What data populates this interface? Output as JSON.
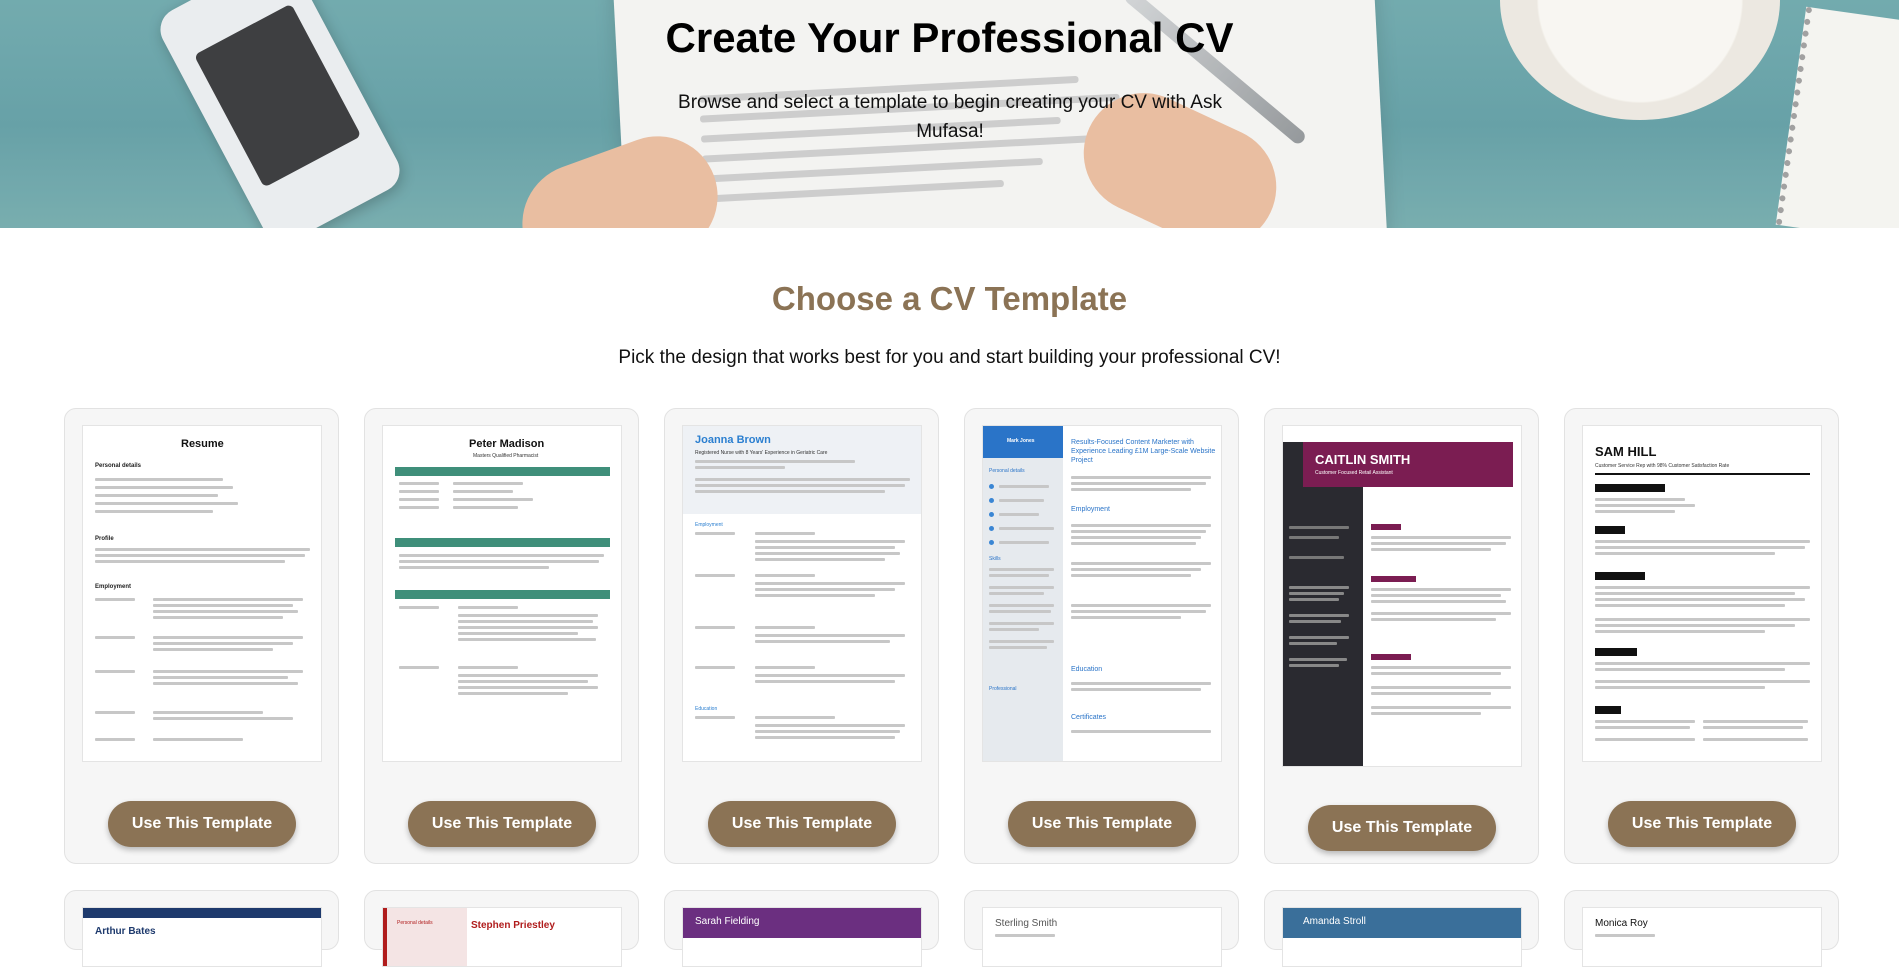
{
  "hero": {
    "title": "Create Your Professional CV",
    "subtitle": "Browse and select a template to begin creating your CV with Ask Mufasa!"
  },
  "section": {
    "title": "Choose a CV Template",
    "subtitle": "Pick the design that works best for you and start building your professional CV!"
  },
  "button_label": "Use This Template",
  "colors": {
    "accent": "#8b7355",
    "title_brown": "#8b7355"
  },
  "templates": [
    {
      "name": "Resume",
      "subtitle": ""
    },
    {
      "name": "Peter Madison",
      "subtitle": "Masters Qualified Pharmacist"
    },
    {
      "name": "Joanna Brown",
      "subtitle": "Registered Nurse with 8 Years' Experience in Geriatric Care"
    },
    {
      "name": "Mark Jones",
      "subtitle": "Results-Focused Content Marketer with Experience Leading £1M Large-Scale Website Project"
    },
    {
      "name": "CAITLIN SMITH",
      "subtitle": "Customer Focused Retail Assistant"
    },
    {
      "name": "SAM HILL",
      "subtitle": "Customer Service Rep with 98% Customer Satisfaction Rate"
    }
  ],
  "templates_row2": [
    {
      "name": "Arthur Bates"
    },
    {
      "name": "Stephen Priestley",
      "side_label": "Personal details"
    },
    {
      "name": "Sarah Fielding"
    },
    {
      "name": "Sterling Smith"
    },
    {
      "name": "Amanda Stroll"
    },
    {
      "name": "Monica Roy"
    }
  ]
}
